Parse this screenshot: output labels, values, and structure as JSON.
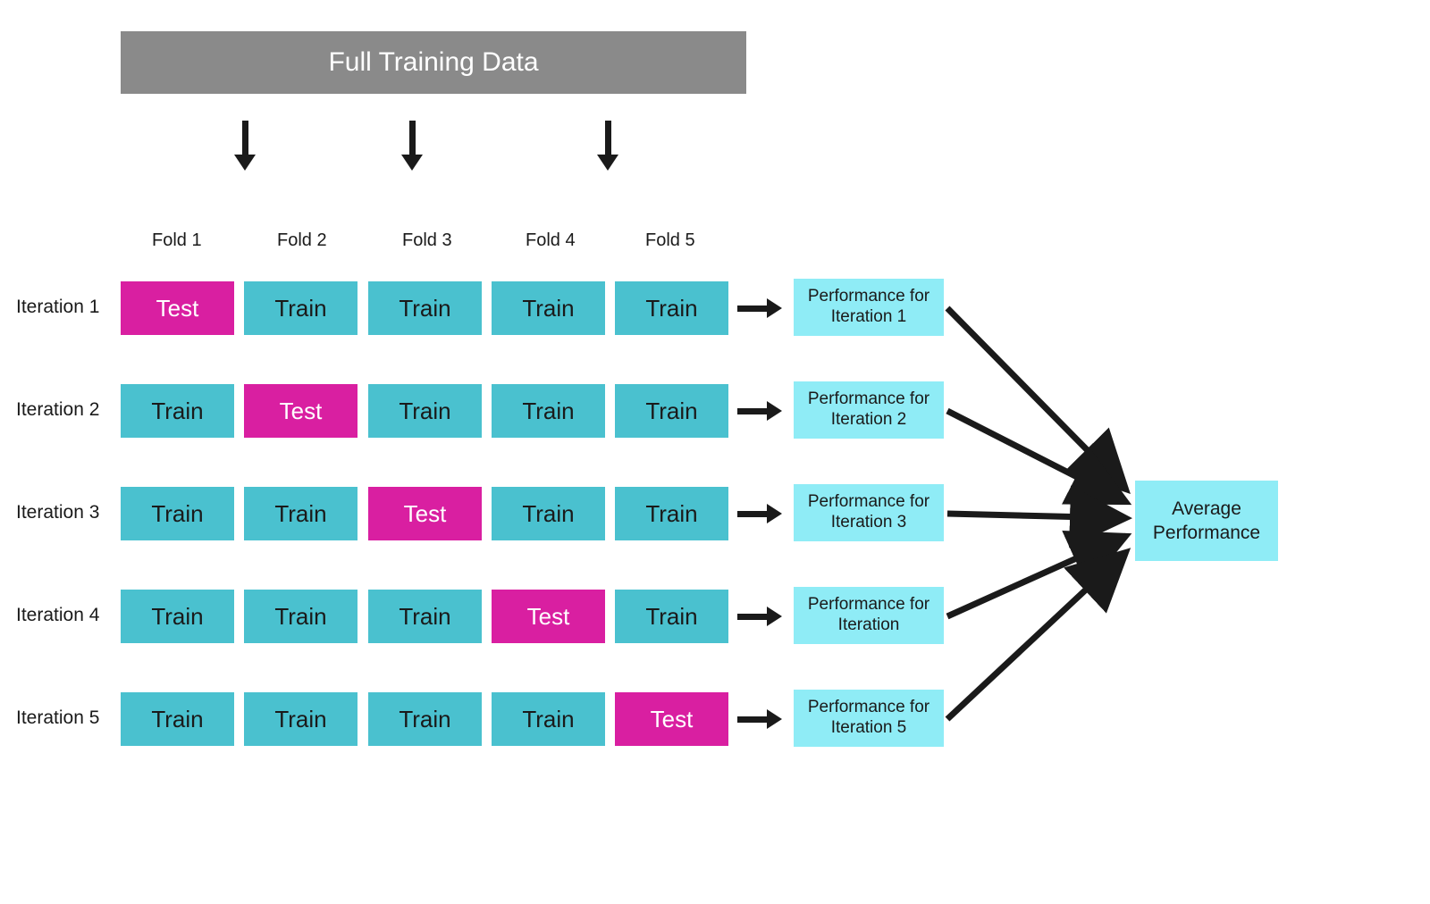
{
  "header": {
    "title": "Full Training Data"
  },
  "folds": [
    "Fold 1",
    "Fold 2",
    "Fold 3",
    "Fold 4",
    "Fold 5"
  ],
  "iterations": [
    "Iteration 1",
    "Iteration 2",
    "Iteration 3",
    "Iteration 4",
    "Iteration 5"
  ],
  "cells": {
    "train": "Train",
    "test": "Test"
  },
  "grid": [
    [
      "Test",
      "Train",
      "Train",
      "Train",
      "Train"
    ],
    [
      "Train",
      "Test",
      "Train",
      "Train",
      "Train"
    ],
    [
      "Train",
      "Train",
      "Test",
      "Train",
      "Train"
    ],
    [
      "Train",
      "Train",
      "Train",
      "Test",
      "Train"
    ],
    [
      "Train",
      "Train",
      "Train",
      "Train",
      "Test"
    ]
  ],
  "performance": [
    "Performance for Iteration 1",
    "Performance for Iteration 2",
    "Performance for Iteration 3",
    "Performance for Iteration",
    "Performance for Iteration 5"
  ],
  "average": "Average Performance",
  "colors": {
    "train": "#4ac1cf",
    "test": "#d91fa1",
    "perf": "#8fecf6",
    "header": "#8a8a8a",
    "arrow": "#1a1a1a"
  }
}
